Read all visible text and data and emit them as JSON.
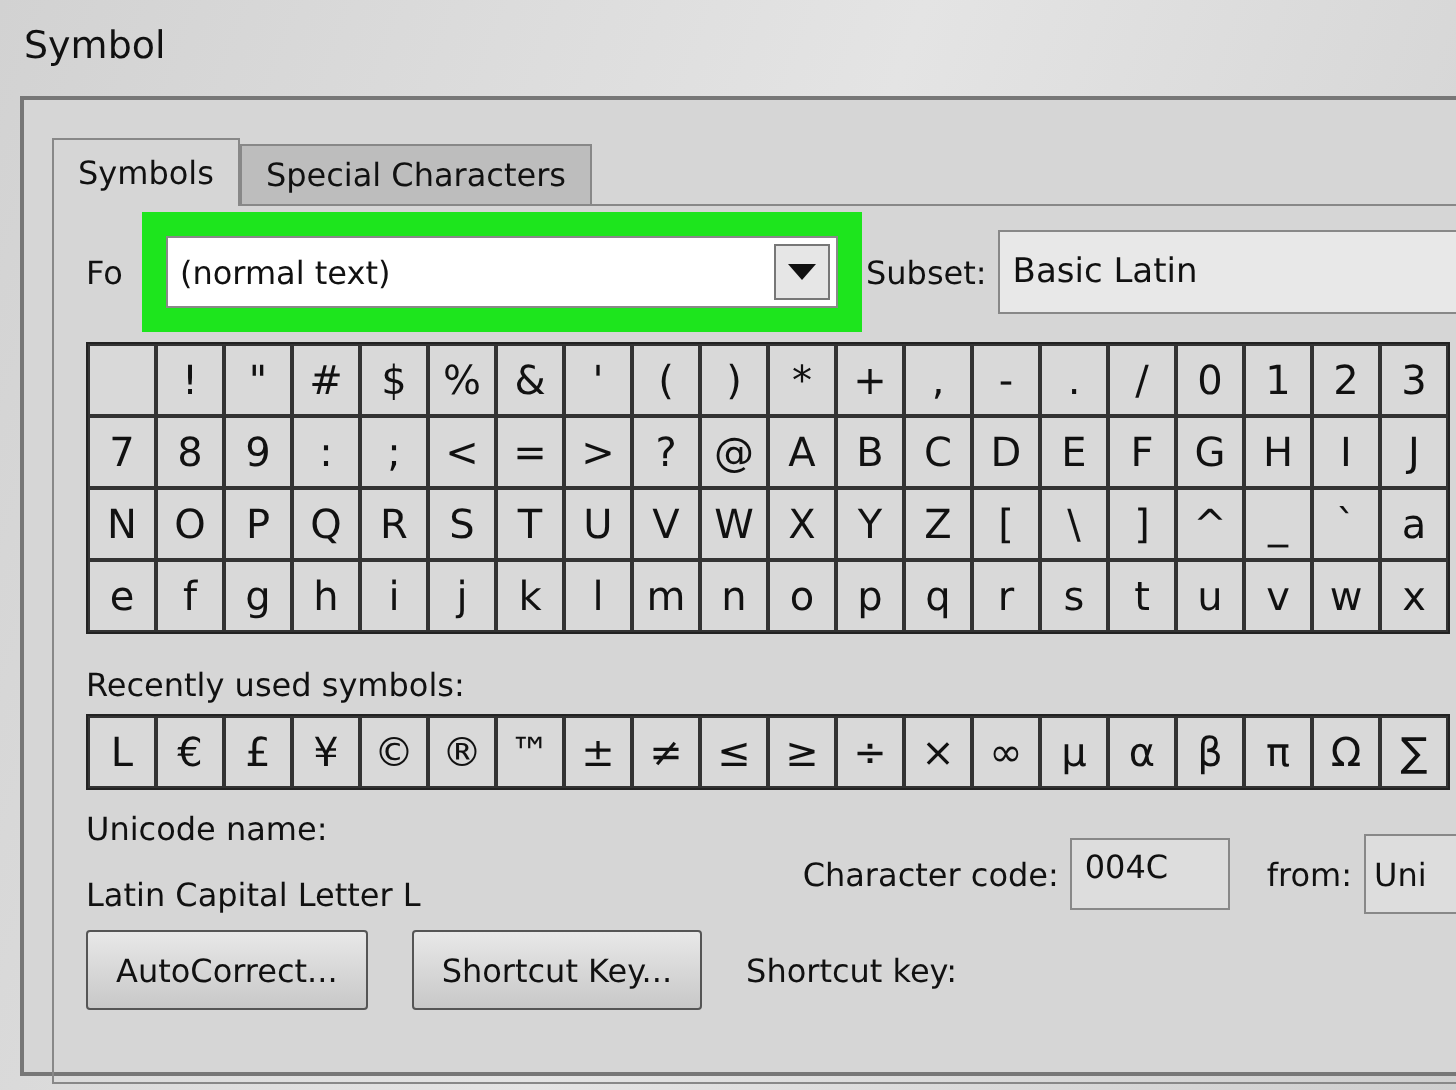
{
  "window": {
    "title": "Symbol"
  },
  "tabs": [
    {
      "label": "Symbols",
      "selected": true
    },
    {
      "label": "Special Characters",
      "selected": false
    }
  ],
  "font": {
    "label": "Fo",
    "value": "(normal text)",
    "highlighted": true
  },
  "subset": {
    "label": "Subset:",
    "value": "Basic Latin"
  },
  "symbol_grid": [
    {
      "leading_blank_cell": true,
      "symbols": [
        "!",
        "\"",
        "#",
        "$",
        "%",
        "&",
        "'",
        "(",
        ")",
        "*",
        "+",
        ",",
        "-",
        ".",
        "/",
        "0",
        "1",
        "2",
        "3"
      ]
    },
    {
      "symbols": [
        "7",
        "8",
        "9",
        ":",
        ";",
        "<",
        "=",
        ">",
        "?",
        "@",
        "A",
        "B",
        "C",
        "D",
        "E",
        "F",
        "G",
        "H",
        "I",
        "J"
      ]
    },
    {
      "symbols": [
        "N",
        "O",
        "P",
        "Q",
        "R",
        "S",
        "T",
        "U",
        "V",
        "W",
        "X",
        "Y",
        "Z",
        "[",
        "\\",
        "]",
        "^",
        "_",
        "`",
        "a"
      ]
    },
    {
      "symbols": [
        "e",
        "f",
        "g",
        "h",
        "i",
        "j",
        "k",
        "l",
        "m",
        "n",
        "o",
        "p",
        "q",
        "r",
        "s",
        "t",
        "u",
        "v",
        "w",
        "x"
      ]
    }
  ],
  "recently_used": {
    "label": "Recently used symbols:",
    "symbols": [
      "L",
      "€",
      "£",
      "¥",
      "©",
      "®",
      "™",
      "±",
      "≠",
      "≤",
      "≥",
      "÷",
      "×",
      "∞",
      "μ",
      "α",
      "β",
      "π",
      "Ω",
      "∑"
    ]
  },
  "unicode_name": {
    "label": "Unicode name:",
    "value": "Latin Capital Letter L"
  },
  "character_code": {
    "label": "Character code:",
    "value": "004C"
  },
  "from": {
    "label": "from:",
    "value": "Uni"
  },
  "buttons": [
    "AutoCorrect...",
    "Shortcut Key..."
  ],
  "shortcut_key": {
    "label": "Shortcut key:"
  }
}
